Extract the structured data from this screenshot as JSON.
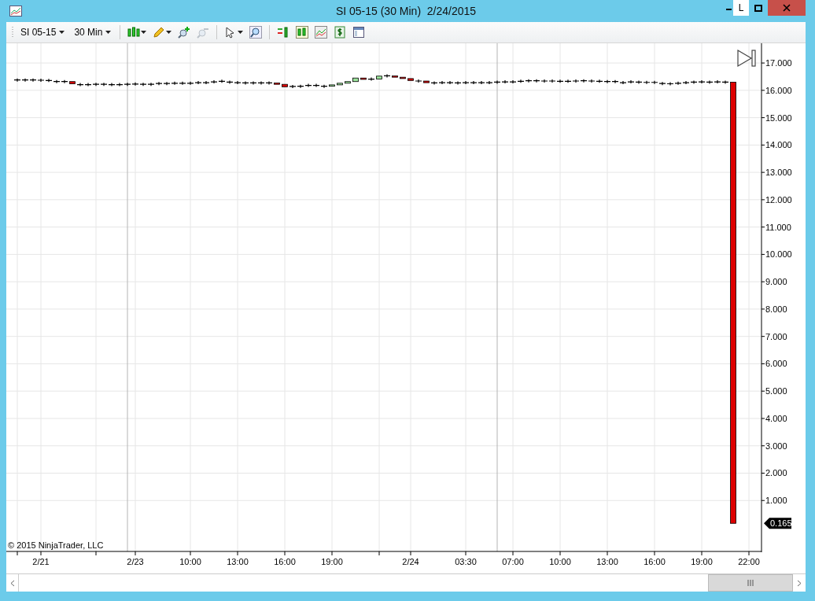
{
  "window": {
    "title": "SI 05-15 (30 Min)  2/24/2015",
    "controls": [
      {
        "kind": "minimize"
      },
      {
        "kind": "label",
        "text": "L"
      },
      {
        "kind": "maximize"
      },
      {
        "kind": "close"
      }
    ]
  },
  "toolbar": {
    "instrument": "SI 05-15",
    "interval": "30 Min",
    "tools": [
      {
        "kind": "candles",
        "dropdown": true,
        "disabled": false
      },
      {
        "kind": "pencil",
        "dropdown": true,
        "disabled": false
      },
      {
        "kind": "zoom-in",
        "dropdown": false,
        "disabled": false
      },
      {
        "kind": "zoom-out",
        "dropdown": false,
        "disabled": true
      },
      {
        "kind": "pointer",
        "dropdown": true,
        "disabled": false
      },
      {
        "kind": "magnifier",
        "dropdown": false,
        "disabled": false
      },
      {
        "kind": "strategy",
        "dropdown": false,
        "disabled": false
      },
      {
        "kind": "indicator",
        "dropdown": false,
        "disabled": false
      },
      {
        "kind": "area",
        "dropdown": false,
        "disabled": false
      },
      {
        "kind": "dollar",
        "dropdown": false,
        "disabled": false
      },
      {
        "kind": "properties",
        "dropdown": false,
        "disabled": false
      }
    ]
  },
  "chart": {
    "copyright": "© 2015 NinjaTrader, LLC",
    "price_tag": "0.165",
    "y_axis_labels": [
      "17.000",
      "16.000",
      "15.000",
      "14.000",
      "13.000",
      "12.000",
      "11.000",
      "10.000",
      "9.000",
      "8.000",
      "7.000",
      "6.000",
      "5.000",
      "4.000",
      "3.000",
      "2.000",
      "1.000"
    ],
    "x_axis_labels": [
      "2/21",
      "2/23",
      "10:00",
      "13:00",
      "16:00",
      "19:00",
      "2/24",
      "03:30",
      "07:00",
      "10:00",
      "13:00",
      "16:00",
      "19:00",
      "22:00"
    ]
  }
}
